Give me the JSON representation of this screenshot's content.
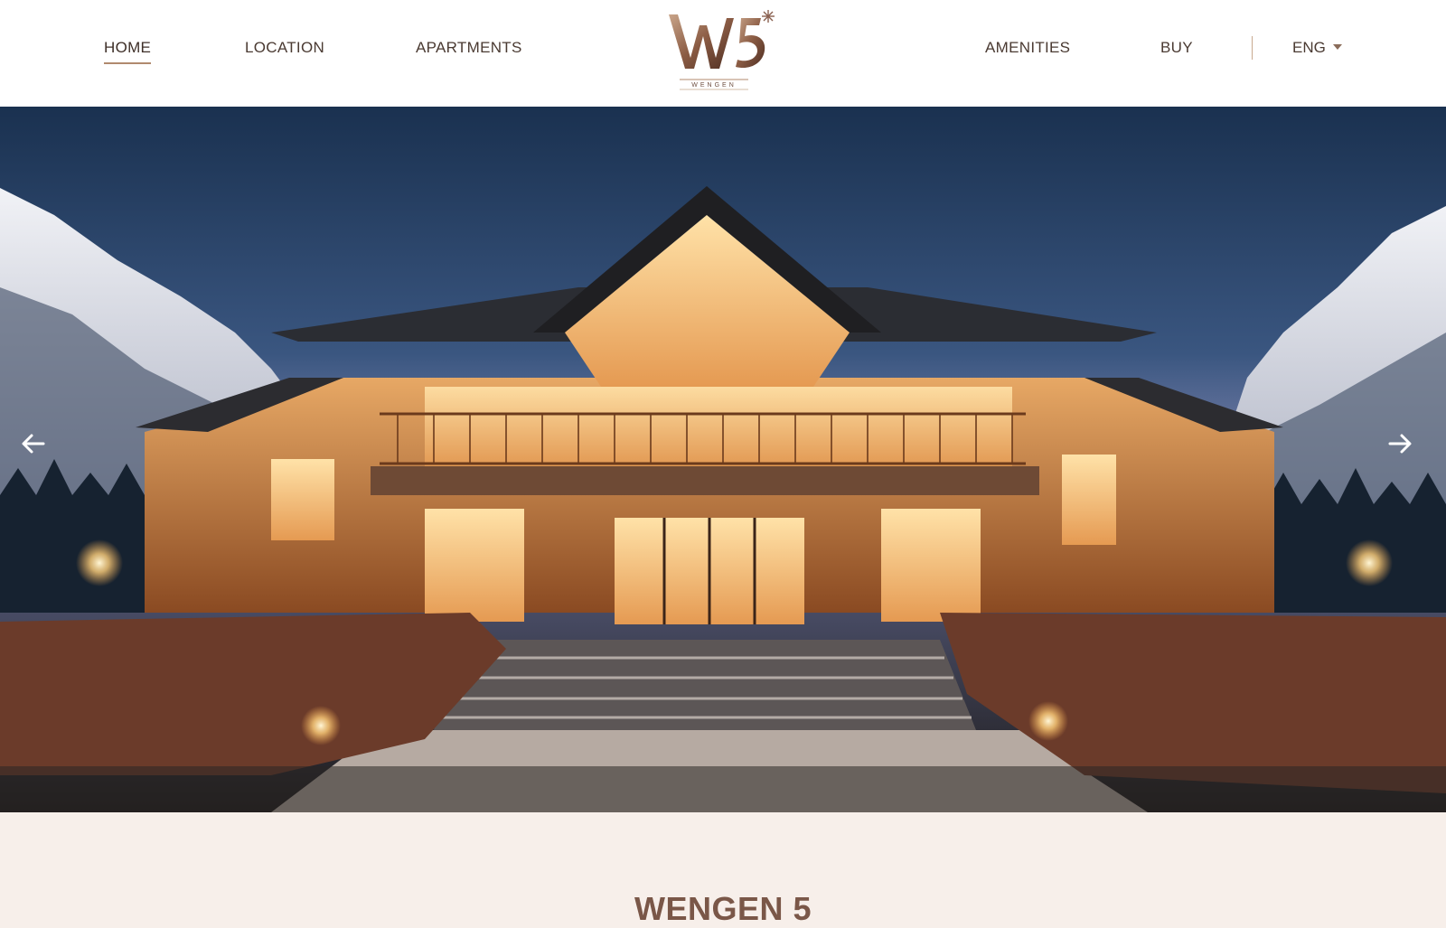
{
  "nav": {
    "left": [
      {
        "label": "HOME",
        "active": true
      },
      {
        "label": "LOCATION"
      },
      {
        "label": "APARTMENTS"
      }
    ],
    "right": [
      {
        "label": "AMENITIES"
      },
      {
        "label": "BUY"
      }
    ],
    "language": "ENG"
  },
  "logo": {
    "mark": "W5",
    "name": "WENGEN",
    "icon": "snowflake-icon"
  },
  "hero": {
    "image": "illuminated wooden chalet at dusk with snowy mountains",
    "prev_icon": "arrow-left-icon",
    "next_icon": "arrow-right-icon"
  },
  "main": {
    "title": "WENGEN 5"
  },
  "colors": {
    "accent": "#b08a6e",
    "text": "#4a3a32",
    "title": "#7a5748",
    "background": "#f7efea"
  }
}
